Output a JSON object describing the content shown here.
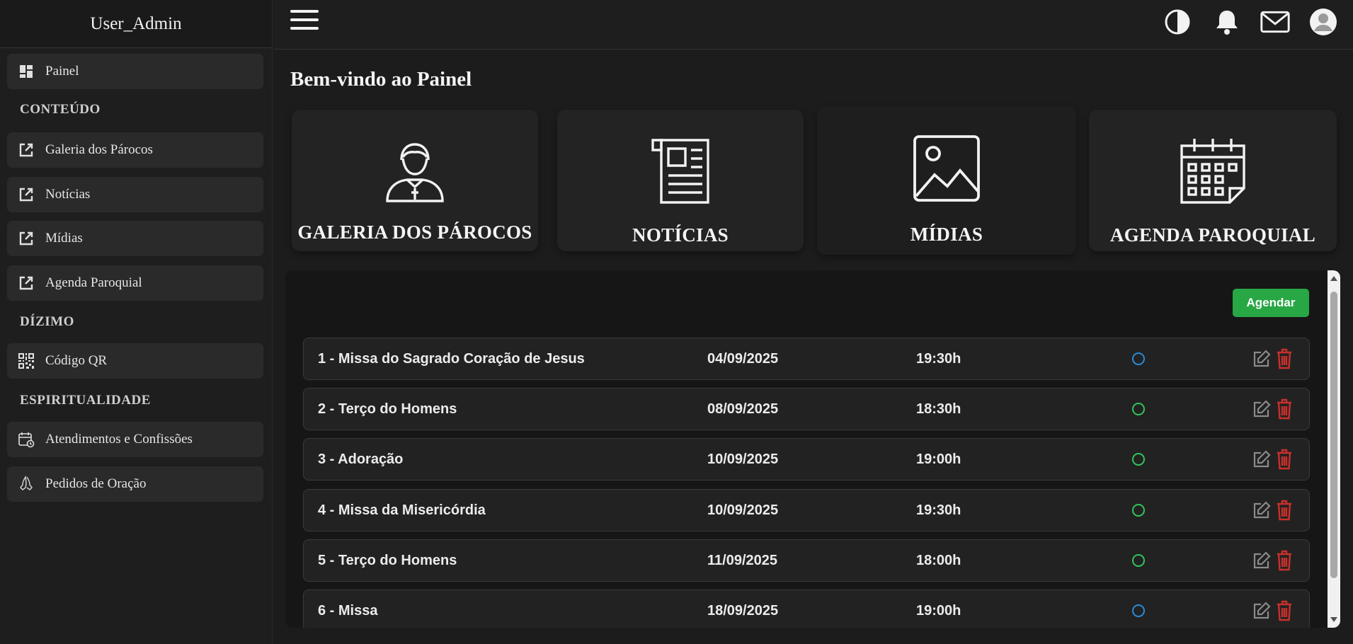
{
  "sidebar": {
    "user": "User_Admin",
    "painel": "Painel",
    "section_conteudo": "CONTEÚDO",
    "galeria": "Galeria dos Párocos",
    "noticias": "Notícias",
    "midias": "Mídias",
    "agenda": "Agenda Paroquial",
    "section_dizimo": "DÍZIMO",
    "codigo_qr": "Código QR",
    "section_espiritualidade": "ESPIRITUALIDADE",
    "atendimentos": "Atendimentos e Confissões",
    "pedidos": "Pedidos de Oração"
  },
  "main": {
    "title": "Bem-vindo ao Painel",
    "cards": [
      "GALERIA DOS PÁROCOS",
      "NOTÍCIAS",
      "MÍDIAS",
      "AGENDA PAROQUIAL"
    ]
  },
  "agenda": {
    "button_label": "Agendar",
    "rows": [
      {
        "name": "1 - Missa do Sagrado Coração de Jesus",
        "date": "04/09/2025",
        "time": "19:30h",
        "status_color": "#2a8bd6"
      },
      {
        "name": "2 - Terço do Homens",
        "date": "08/09/2025",
        "time": "18:30h",
        "status_color": "#33c45a"
      },
      {
        "name": "3 - Adoração",
        "date": "10/09/2025",
        "time": "19:00h",
        "status_color": "#33c45a"
      },
      {
        "name": "4 - Missa da Misericórdia",
        "date": "10/09/2025",
        "time": "19:30h",
        "status_color": "#33c45a"
      },
      {
        "name": "5 - Terço do Homens",
        "date": "11/09/2025",
        "time": "18:00h",
        "status_color": "#33c45a"
      },
      {
        "name": "6 - Missa",
        "date": "18/09/2025",
        "time": "19:00h",
        "status_color": "#2a8bd6"
      }
    ]
  },
  "colors": {
    "accent_green": "#28a745",
    "delete_red": "#c9302c",
    "edit_grey": "#8a8a8a"
  },
  "icons": {
    "topbar": [
      "contrast-icon",
      "bell-icon",
      "mail-icon",
      "avatar-icon"
    ]
  }
}
